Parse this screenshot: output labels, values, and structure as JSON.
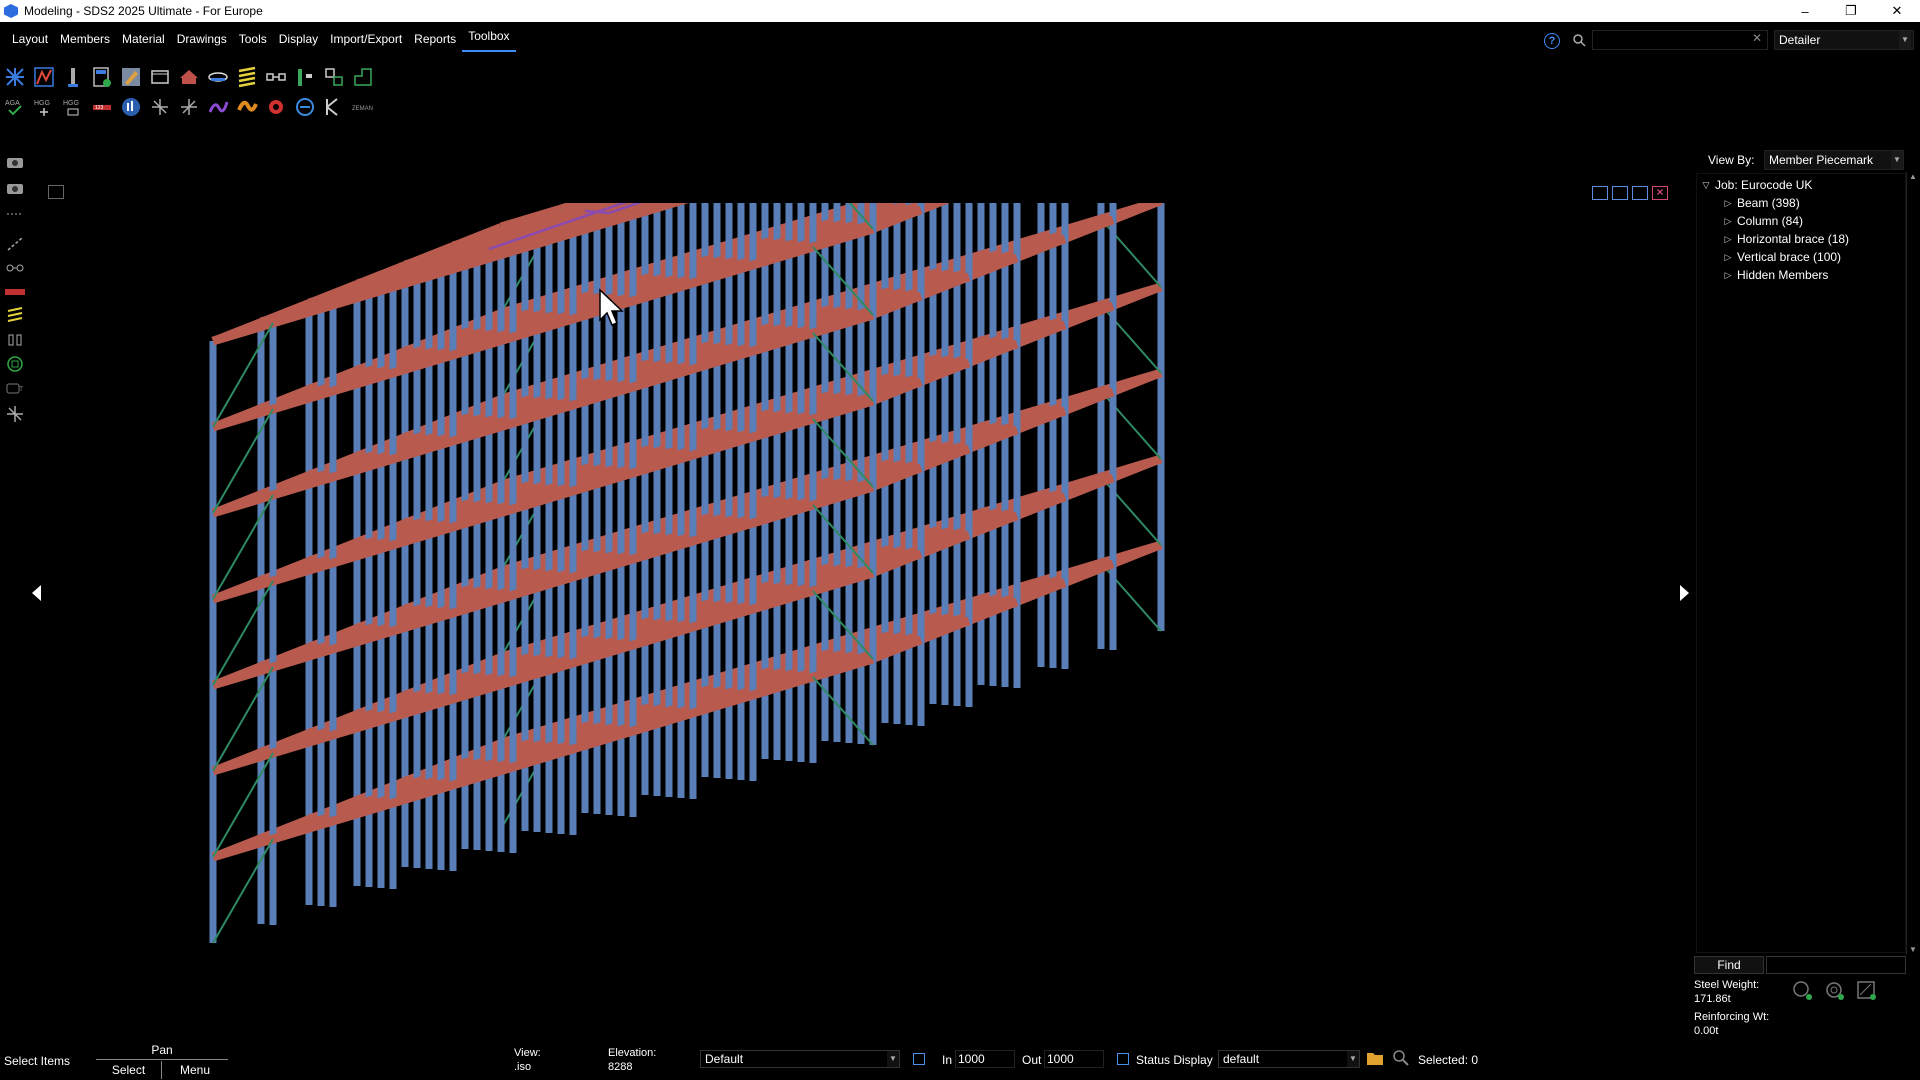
{
  "window": {
    "title": "Modeling - SDS2 2025 Ultimate - For Europe",
    "min_glyph": "–",
    "restore_glyph": "❐",
    "close_glyph": "✕"
  },
  "menu": {
    "items": [
      "Layout",
      "Members",
      "Material",
      "Drawings",
      "Tools",
      "Display",
      "Import/Export",
      "Reports",
      "Toolbox"
    ],
    "active": "Toolbox"
  },
  "header": {
    "help_glyph": "?",
    "search_placeholder": "",
    "search_value": "",
    "clear_glyph": "✕",
    "role": "Detailer"
  },
  "toolbar": {
    "row1_icons": [
      "grid-icon",
      "member-layout-icon",
      "column-icon",
      "calculator-icon",
      "edit-icon",
      "window-icon",
      "roof-icon",
      "stair-icon",
      "stripes-icon",
      "connection-icon",
      "frame-icon",
      "elevation-icon",
      "plan-icon"
    ],
    "row2_icons": [
      "auto-check-icon",
      "hgg-add-icon",
      "hgg-remove-icon",
      "numbering-icon",
      "chart-icon",
      "node-icon",
      "node-alt-icon",
      "purple-tool-icon",
      "orange-tool-icon",
      "gear-red-icon",
      "sync-icon",
      "cursor-k-icon",
      "zeman-icon"
    ],
    "row2_labels": {
      "hgg1": "HGG",
      "hgg2": "HGG",
      "zeman": "ZEMAN",
      "k": "K"
    }
  },
  "left_tools": [
    "camera-icon",
    "camera-alt-icon",
    "dotted-line-icon",
    "measure-icon",
    "link-icon",
    "numbering-icon",
    "stripes-icon",
    "bolt-icon",
    "circle-tool-icon",
    "camera-t-icon",
    "move-icon"
  ],
  "viewport": {
    "background": "#000000",
    "beam_color": "#b85a4e",
    "column_color": "#5a7fb8",
    "brace_color": "#2e8a62",
    "hbrace_color": "#8a4bb0"
  },
  "right_panel": {
    "view_by_label": "View By:",
    "view_by_value": "Member Piecemark",
    "tree": {
      "root": "Job: Eurocode UK",
      "children": [
        "Beam (398)",
        "Column (84)",
        "Horizontal brace (18)",
        "Vertical brace (100)",
        "Hidden Members"
      ]
    },
    "find_label": "Find",
    "steel_weight_label": "Steel Weight:",
    "steel_weight_value": "171.86t",
    "reinforcing_label": "Reinforcing Wt:",
    "reinforcing_value": "0.00t"
  },
  "status": {
    "prompt": "Select Items",
    "mode_pan": "Pan",
    "mode_select": "Select",
    "mode_menu": "Menu",
    "view_label": "View:",
    "view_value": ".iso",
    "elevation_label": "Elevation:",
    "elevation_value": "8288",
    "layer_select": "Default",
    "in_label": "In",
    "in_value": "1000",
    "out_label": "Out",
    "out_value": "1000",
    "status_display_label": "Status Display",
    "status_select": "default",
    "selected_label": "Selected: 0"
  }
}
